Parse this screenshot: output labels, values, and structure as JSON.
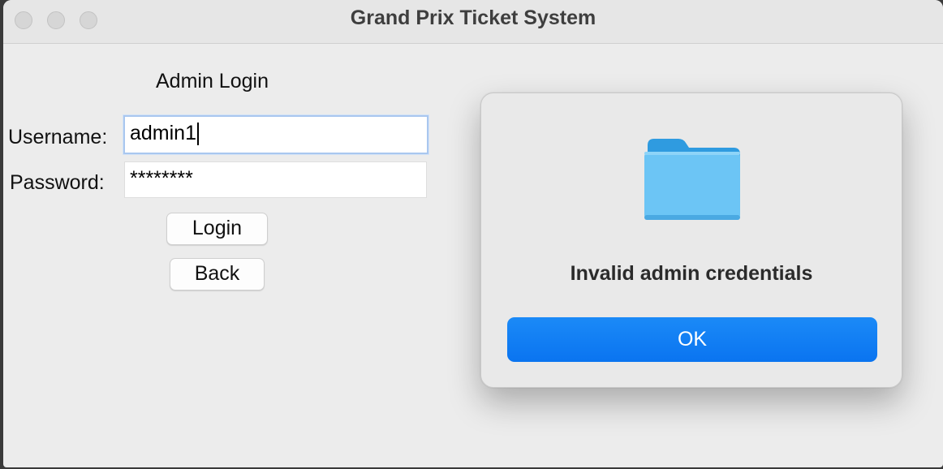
{
  "window": {
    "title": "Grand Prix Ticket System"
  },
  "login_form": {
    "heading": "Admin Login",
    "username_label": "Username:",
    "username_value": "admin1",
    "password_label": "Password:",
    "password_value": "********",
    "login_button": "Login",
    "back_button": "Back"
  },
  "alert": {
    "icon": "folder-icon",
    "message": "Invalid admin credentials",
    "ok_button": "OK"
  },
  "colors": {
    "accent": "#0a74f0",
    "folder": "#6cc5f5"
  }
}
